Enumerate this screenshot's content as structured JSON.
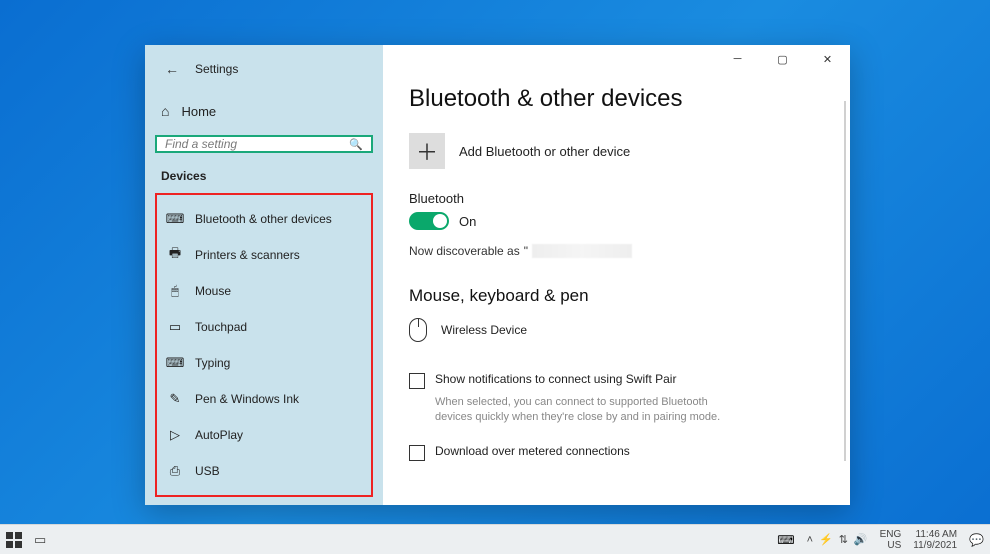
{
  "window": {
    "title": "Settings"
  },
  "sidebar": {
    "home": "Home",
    "search_placeholder": "Find a setting",
    "category": "Devices",
    "items": [
      {
        "label": "Bluetooth & other devices",
        "icon": "⌨"
      },
      {
        "label": "Printers & scanners",
        "icon": "🖶"
      },
      {
        "label": "Mouse",
        "icon": "🖱"
      },
      {
        "label": "Touchpad",
        "icon": "▭"
      },
      {
        "label": "Typing",
        "icon": "⌨"
      },
      {
        "label": "Pen & Windows Ink",
        "icon": "✎"
      },
      {
        "label": "AutoPlay",
        "icon": "▷"
      },
      {
        "label": "USB",
        "icon": "⎙"
      }
    ]
  },
  "main": {
    "heading": "Bluetooth & other devices",
    "add_label": "Add Bluetooth or other device",
    "bt_label": "Bluetooth",
    "bt_state": "On",
    "discoverable_prefix": "Now discoverable as",
    "mkp_heading": "Mouse, keyboard & pen",
    "device_1": "Wireless Device",
    "swift_pair": "Show notifications to connect using Swift Pair",
    "swift_help": "When selected, you can connect to supported Bluetooth devices quickly when they're close by and in pairing mode.",
    "metered": "Download over metered connections"
  },
  "taskbar": {
    "lang": "ENG",
    "locale": "US",
    "time": "11:46 AM",
    "date": "11/9/2021"
  }
}
